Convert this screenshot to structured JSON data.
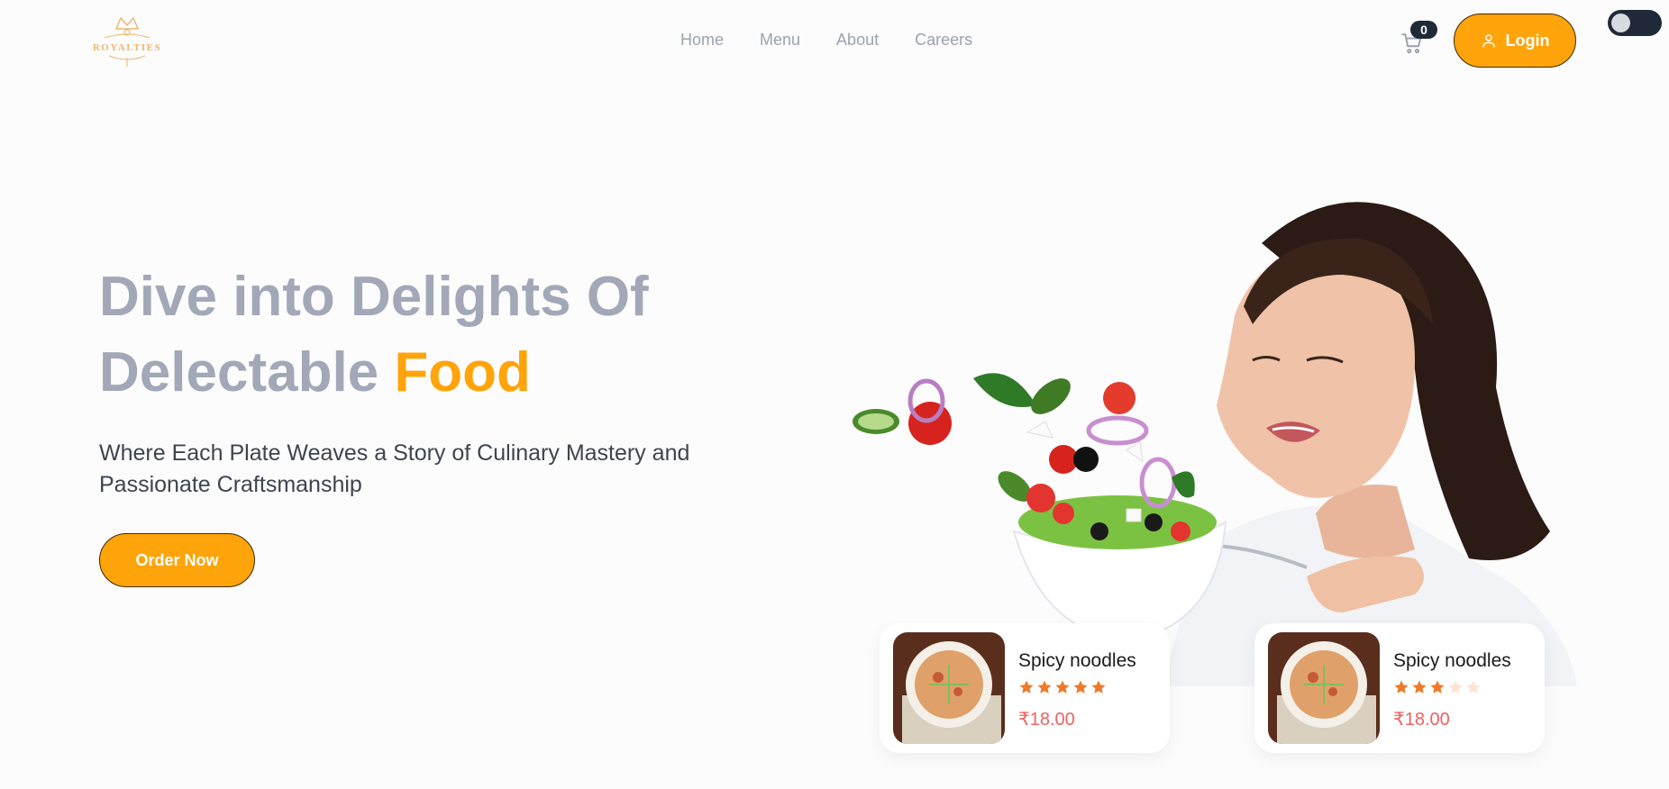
{
  "brand": {
    "logo_text": "ROYALTIES"
  },
  "nav": {
    "items": [
      {
        "label": "Home"
      },
      {
        "label": "Menu"
      },
      {
        "label": "About"
      },
      {
        "label": "Careers"
      }
    ]
  },
  "header": {
    "cart_count": "0",
    "cart_icon": "cart-icon",
    "login_label": "Login",
    "login_icon": "user-icon",
    "theme_toggle_state": "light"
  },
  "hero": {
    "title_line1": "Dive into Delights Of",
    "title_line2_prefix": "Delectable ",
    "title_accent": "Food",
    "subtitle": "Where Each Plate Weaves a Story of Culinary Mastery and Passionate Craftsmanship",
    "cta_label": "Order Now"
  },
  "food_cards": [
    {
      "name": "Spicy noodles",
      "rating": 5,
      "max_rating": 5,
      "price": "₹18.00"
    },
    {
      "name": "Spicy noodles",
      "rating": 3,
      "max_rating": 5,
      "price": "₹18.00"
    }
  ],
  "colors": {
    "accent": "#ffa40b",
    "heading_gray": "#a2a8b7",
    "price_red": "#f06060",
    "star_filled": "#f07a2a",
    "star_empty": "#fde3d2",
    "dark": "#1f2937"
  }
}
